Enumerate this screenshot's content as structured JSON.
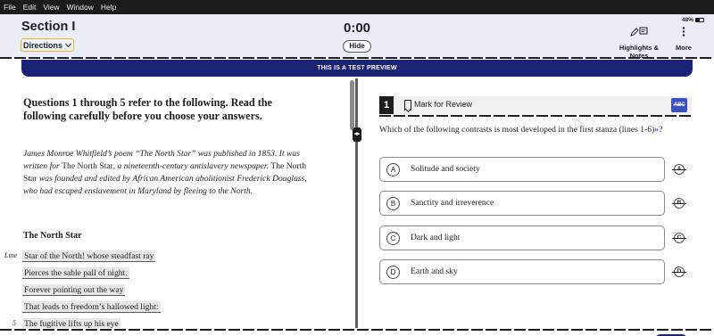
{
  "menubar": {
    "items": [
      "File",
      "Edit",
      "View",
      "Window",
      "Help"
    ]
  },
  "header": {
    "section_title": "Section I",
    "directions_label": "Directions",
    "timer": "0:00",
    "hide_label": "Hide",
    "battery": "48%",
    "highlights_label": "Highlights & Notes",
    "more_label": "More"
  },
  "banner": {
    "text": "THIS IS A TEST PREVIEW"
  },
  "passage": {
    "intro": "Questions 1 through 5 refer to the following. Read the following carefully before you choose your answers.",
    "context_parts": [
      "James Monroe Whitfield’s poem “The North Star” was published in 1853. It was written for ",
      "The North Star",
      ", a nineteenth-century antislavery newspaper. ",
      "The North Star",
      " was founded and edited by African American abolitionist Frederick Douglass, who had escaped enslavement in Maryland by fleeing to the North."
    ],
    "poem_title": "The North Star",
    "line_label": "Line",
    "line_number": "5",
    "lines": [
      "Star of the North! whose steadfast ray",
      "Pierces the sable pall of night.",
      "Forever pointing out the way",
      "That leads to freedom’s hallowed light:",
      "The fugitive lifts up his eye"
    ]
  },
  "question": {
    "number": "1",
    "mark_label": "Mark for Review",
    "abc_label": "ABC",
    "text": "Which of the following contrasts is most developed in the first stanza (lines 1-6)",
    "text_end": "?",
    "arrow": "»",
    "options": [
      {
        "letter": "A",
        "text": "Solitude and society"
      },
      {
        "letter": "B",
        "text": "Sanctity and irreverence"
      },
      {
        "letter": "C",
        "text": "Dark and light"
      },
      {
        "letter": "D",
        "text": "Earth and sky"
      }
    ]
  },
  "colors": {
    "banner": "#1a2375",
    "accent": "#3a4fc0",
    "directions_border": "#e8b91e"
  },
  "icons": [
    "pen-icon",
    "note-icon",
    "kebab-menu-icon",
    "bookmark-icon",
    "battery-icon",
    "resize-grip-icon"
  ]
}
